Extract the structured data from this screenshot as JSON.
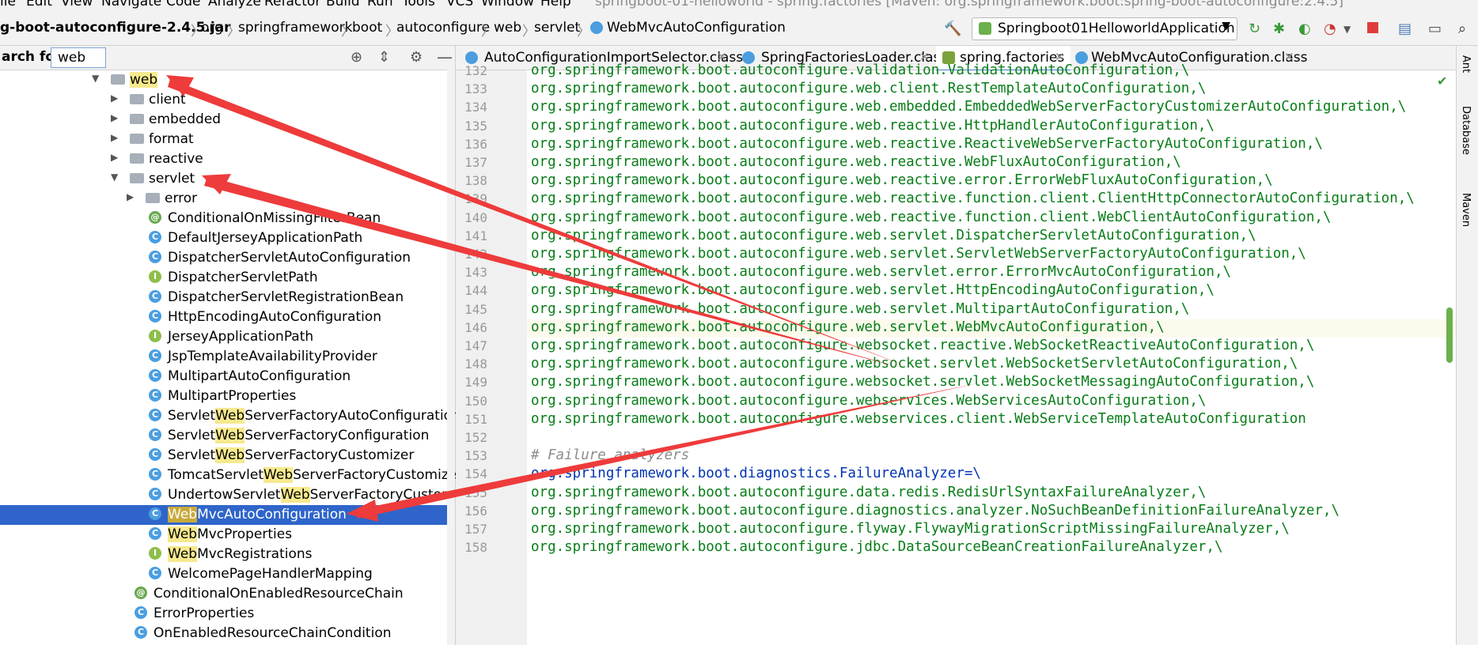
{
  "menu": {
    "items": [
      "ile",
      "Edit",
      "View",
      "Navigate",
      "Code",
      "Analyze",
      "Refactor",
      "Build",
      "Run",
      "Tools",
      "VCS",
      "Window",
      "Help"
    ],
    "window_title": "springboot-01-helloworld - spring.factories [Maven: org.springframework.boot:spring-boot-autoconfigure:2.4.5]"
  },
  "breadcrumb": {
    "items": [
      "g-boot-autoconfigure-2.4.5.jar",
      "org",
      "springframework",
      "boot",
      "autoconfigure",
      "web",
      "servlet",
      "WebMvcAutoConfiguration"
    ],
    "separator": "〉"
  },
  "run_config": {
    "label": "Springboot01HelloworldApplication"
  },
  "search": {
    "label": "arch for:",
    "value": "web"
  },
  "tree": {
    "rows": [
      {
        "label_pre": "",
        "label_hl": "web",
        "label_post": "",
        "type": "folder",
        "arrow": "expanded"
      },
      {
        "label_pre": "client",
        "label_hl": "",
        "label_post": "",
        "type": "folder",
        "arrow": "collapsed"
      },
      {
        "label_pre": "embedded",
        "label_hl": "",
        "label_post": "",
        "type": "folder",
        "arrow": "collapsed"
      },
      {
        "label_pre": "format",
        "label_hl": "",
        "label_post": "",
        "type": "folder",
        "arrow": "collapsed"
      },
      {
        "label_pre": "reactive",
        "label_hl": "",
        "label_post": "",
        "type": "folder",
        "arrow": "collapsed"
      },
      {
        "label_pre": "servlet",
        "label_hl": "",
        "label_post": "",
        "type": "folder",
        "arrow": "expanded"
      },
      {
        "label_pre": "error",
        "label_hl": "",
        "label_post": "",
        "type": "folder",
        "arrow": "collapsed"
      },
      {
        "label_pre": "ConditionalOnMissingFilterBean",
        "label_hl": "",
        "label_post": "",
        "type": "annotation"
      },
      {
        "label_pre": "DefaultJerseyApplicationPath",
        "label_hl": "",
        "label_post": "",
        "type": "class"
      },
      {
        "label_pre": "DispatcherServletAutoConfiguration",
        "label_hl": "",
        "label_post": "",
        "type": "class"
      },
      {
        "label_pre": "DispatcherServletPath",
        "label_hl": "",
        "label_post": "",
        "type": "interface"
      },
      {
        "label_pre": "DispatcherServletRegistrationBean",
        "label_hl": "",
        "label_post": "",
        "type": "class"
      },
      {
        "label_pre": "HttpEncodingAutoConfiguration",
        "label_hl": "",
        "label_post": "",
        "type": "class"
      },
      {
        "label_pre": "JerseyApplicationPath",
        "label_hl": "",
        "label_post": "",
        "type": "interface"
      },
      {
        "label_pre": "JspTemplateAvailabilityProvider",
        "label_hl": "",
        "label_post": "",
        "type": "class"
      },
      {
        "label_pre": "MultipartAutoConfiguration",
        "label_hl": "",
        "label_post": "",
        "type": "class"
      },
      {
        "label_pre": "MultipartProperties",
        "label_hl": "",
        "label_post": "",
        "type": "class"
      },
      {
        "label_pre": "Servlet",
        "label_hl": "Web",
        "label_post": "ServerFactoryAutoConfiguration",
        "type": "class"
      },
      {
        "label_pre": "Servlet",
        "label_hl": "Web",
        "label_post": "ServerFactoryConfiguration",
        "type": "class"
      },
      {
        "label_pre": "Servlet",
        "label_hl": "Web",
        "label_post": "ServerFactoryCustomizer",
        "type": "class"
      },
      {
        "label_pre": "TomcatServlet",
        "label_hl": "Web",
        "label_post": "ServerFactoryCustomizer",
        "type": "class"
      },
      {
        "label_pre": "UndertowServlet",
        "label_hl": "Web",
        "label_post": "ServerFactoryCustomizer",
        "type": "class"
      },
      {
        "label_pre": "",
        "label_hl": "Web",
        "label_post": "MvcAutoConfiguration",
        "type": "class",
        "selected": true
      },
      {
        "label_pre": "",
        "label_hl": "Web",
        "label_post": "MvcProperties",
        "type": "class"
      },
      {
        "label_pre": "",
        "label_hl": "Web",
        "label_post": "MvcRegistrations",
        "type": "interface"
      },
      {
        "label_pre": "WelcomePageHandlerMapping",
        "label_hl": "",
        "label_post": "",
        "type": "class"
      },
      {
        "label_pre": "ConditionalOnEnabledResourceChain",
        "label_hl": "",
        "label_post": "",
        "type": "annotation"
      },
      {
        "label_pre": "ErrorProperties",
        "label_hl": "",
        "label_post": "",
        "type": "class"
      },
      {
        "label_pre": "OnEnabledResourceChainCondition",
        "label_hl": "",
        "label_post": "",
        "type": "class"
      }
    ]
  },
  "tabs": [
    {
      "label": "AutoConfigurationImportSelector.class",
      "active": false
    },
    {
      "label": "SpringFactoriesLoader.class",
      "active": false
    },
    {
      "label": "spring.factories",
      "active": true
    },
    {
      "label": "WebMvcAutoConfiguration.class",
      "active": false
    }
  ],
  "editor": {
    "lines": [
      {
        "n": "132",
        "text": "org.springframework.boot.autoconfigure.validation.ValidationAutoConfiguration,\\",
        "kind": "value"
      },
      {
        "n": "133",
        "text": "org.springframework.boot.autoconfigure.web.client.RestTemplateAutoConfiguration,\\",
        "kind": "value"
      },
      {
        "n": "134",
        "text": "org.springframework.boot.autoconfigure.web.embedded.EmbeddedWebServerFactoryCustomizerAutoConfiguration,\\",
        "kind": "value"
      },
      {
        "n": "135",
        "text": "org.springframework.boot.autoconfigure.web.reactive.HttpHandlerAutoConfiguration,\\",
        "kind": "value"
      },
      {
        "n": "136",
        "text": "org.springframework.boot.autoconfigure.web.reactive.ReactiveWebServerFactoryAutoConfiguration,\\",
        "kind": "value"
      },
      {
        "n": "137",
        "text": "org.springframework.boot.autoconfigure.web.reactive.WebFluxAutoConfiguration,\\",
        "kind": "value"
      },
      {
        "n": "138",
        "text": "org.springframework.boot.autoconfigure.web.reactive.error.ErrorWebFluxAutoConfiguration,\\",
        "kind": "value"
      },
      {
        "n": "139",
        "text": "org.springframework.boot.autoconfigure.web.reactive.function.client.ClientHttpConnectorAutoConfiguration,\\",
        "kind": "value"
      },
      {
        "n": "140",
        "text": "org.springframework.boot.autoconfigure.web.reactive.function.client.WebClientAutoConfiguration,\\",
        "kind": "value"
      },
      {
        "n": "141",
        "text": "org.springframework.boot.autoconfigure.web.servlet.DispatcherServletAutoConfiguration,\\",
        "kind": "value"
      },
      {
        "n": "142",
        "text": "org.springframework.boot.autoconfigure.web.servlet.ServletWebServerFactoryAutoConfiguration,\\",
        "kind": "value"
      },
      {
        "n": "143",
        "text": "org.springframework.boot.autoconfigure.web.servlet.error.ErrorMvcAutoConfiguration,\\",
        "kind": "value"
      },
      {
        "n": "144",
        "text": "org.springframework.boot.autoconfigure.web.servlet.HttpEncodingAutoConfiguration,\\",
        "kind": "value"
      },
      {
        "n": "145",
        "text": "org.springframework.boot.autoconfigure.web.servlet.MultipartAutoConfiguration,\\",
        "kind": "value"
      },
      {
        "n": "146",
        "text": "org.springframework.boot.autoconfigure.web.servlet.WebMvcAutoConfiguration,\\",
        "kind": "value",
        "current": true
      },
      {
        "n": "147",
        "text": "org.springframework.boot.autoconfigure.websocket.reactive.WebSocketReactiveAutoConfiguration,\\",
        "kind": "value"
      },
      {
        "n": "148",
        "text": "org.springframework.boot.autoconfigure.websocket.servlet.WebSocketServletAutoConfiguration,\\",
        "kind": "value"
      },
      {
        "n": "149",
        "text": "org.springframework.boot.autoconfigure.websocket.servlet.WebSocketMessagingAutoConfiguration,\\",
        "kind": "value"
      },
      {
        "n": "150",
        "text": "org.springframework.boot.autoconfigure.webservices.WebServicesAutoConfiguration,\\",
        "kind": "value"
      },
      {
        "n": "151",
        "text": "org.springframework.boot.autoconfigure.webservices.client.WebServiceTemplateAutoConfiguration",
        "kind": "value"
      },
      {
        "n": "152",
        "text": "",
        "kind": "value"
      },
      {
        "n": "153",
        "text": "# Failure analyzers",
        "kind": "comment"
      },
      {
        "n": "154",
        "text": "org.springframework.boot.diagnostics.FailureAnalyzer=\\",
        "kind": "key"
      },
      {
        "n": "155",
        "text": "org.springframework.boot.autoconfigure.data.redis.RedisUrlSyntaxFailureAnalyzer,\\",
        "kind": "value"
      },
      {
        "n": "156",
        "text": "org.springframework.boot.autoconfigure.diagnostics.analyzer.NoSuchBeanDefinitionFailureAnalyzer,\\",
        "kind": "value"
      },
      {
        "n": "157",
        "text": "org.springframework.boot.autoconfigure.flyway.FlywayMigrationScriptMissingFailureAnalyzer,\\",
        "kind": "value"
      },
      {
        "n": "158",
        "text": "org.springframework.boot.autoconfigure.jdbc.DataSourceBeanCreationFailureAnalyzer,\\",
        "kind": "value"
      }
    ]
  },
  "right_strip": [
    "Ant",
    "Database",
    "Maven"
  ],
  "colors": {
    "annotation_arrow": "#ee3b3b",
    "selection": "#2f65ca",
    "search_highlight": "#f7e98e",
    "code_value": "#067d17",
    "code_key": "#0033b3"
  }
}
